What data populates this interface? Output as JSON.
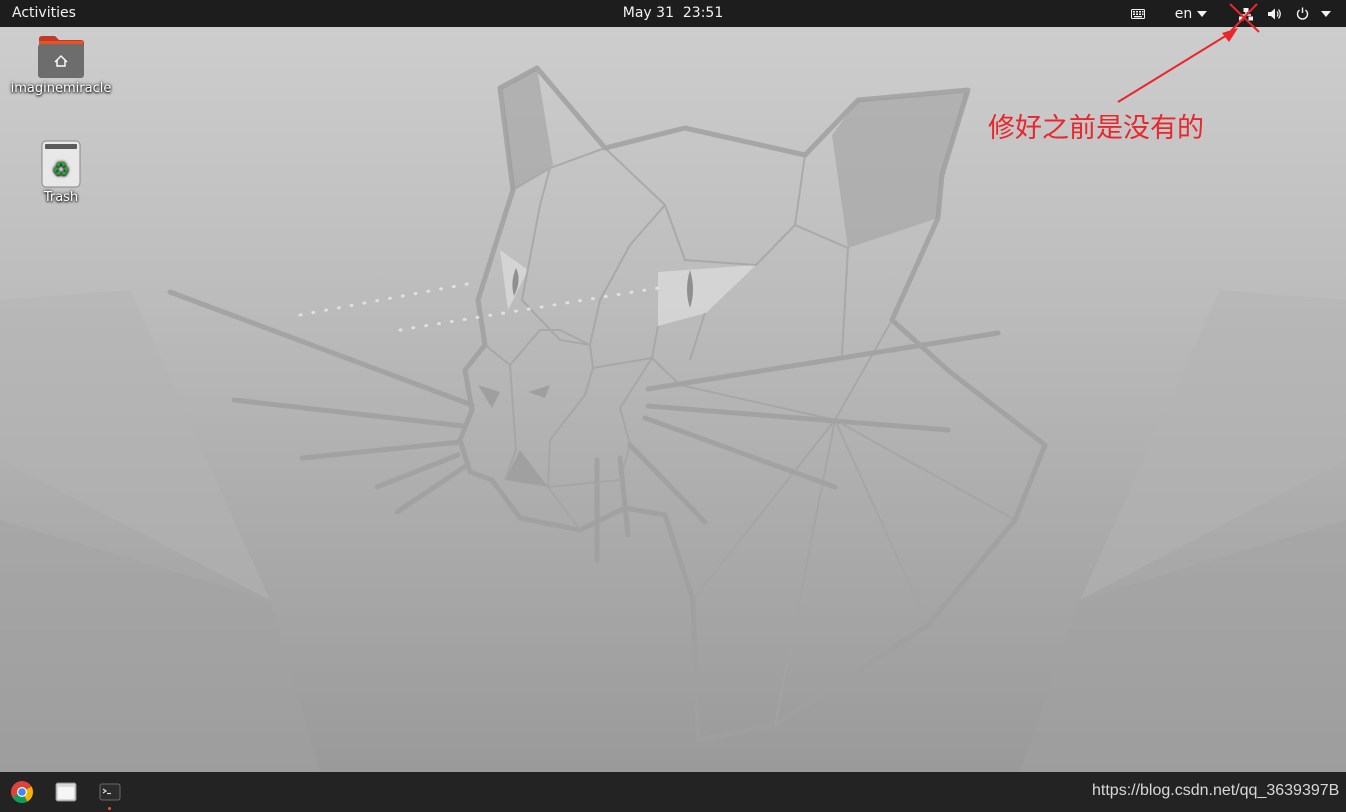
{
  "topbar": {
    "activities": "Activities",
    "clock": "May 31  23:51",
    "language": "en",
    "icons": [
      "keyboard-icon",
      "network-wired-icon",
      "volume-icon",
      "power-icon",
      "chevron-down-icon"
    ]
  },
  "desktop": {
    "icons": [
      {
        "label": "imaginemiracle",
        "icon": "home-folder-icon"
      },
      {
        "label": "Trash",
        "icon": "trash-icon"
      }
    ]
  },
  "annotation": {
    "text": "修好之前是没有的",
    "color": "#e8262b"
  },
  "dock": {
    "apps": [
      {
        "name": "Google Chrome",
        "icon": "chrome-icon"
      },
      {
        "name": "Files",
        "icon": "files-icon"
      },
      {
        "name": "Terminal",
        "icon": "terminal-icon",
        "running": true
      }
    ]
  },
  "watermark": "https://blog.csdn.net/qq_3639397B",
  "colors": {
    "topbar_bg": "#1d1d1d",
    "dock_bg": "#232323",
    "accent": "#e95420",
    "annotation": "#e8262b"
  }
}
